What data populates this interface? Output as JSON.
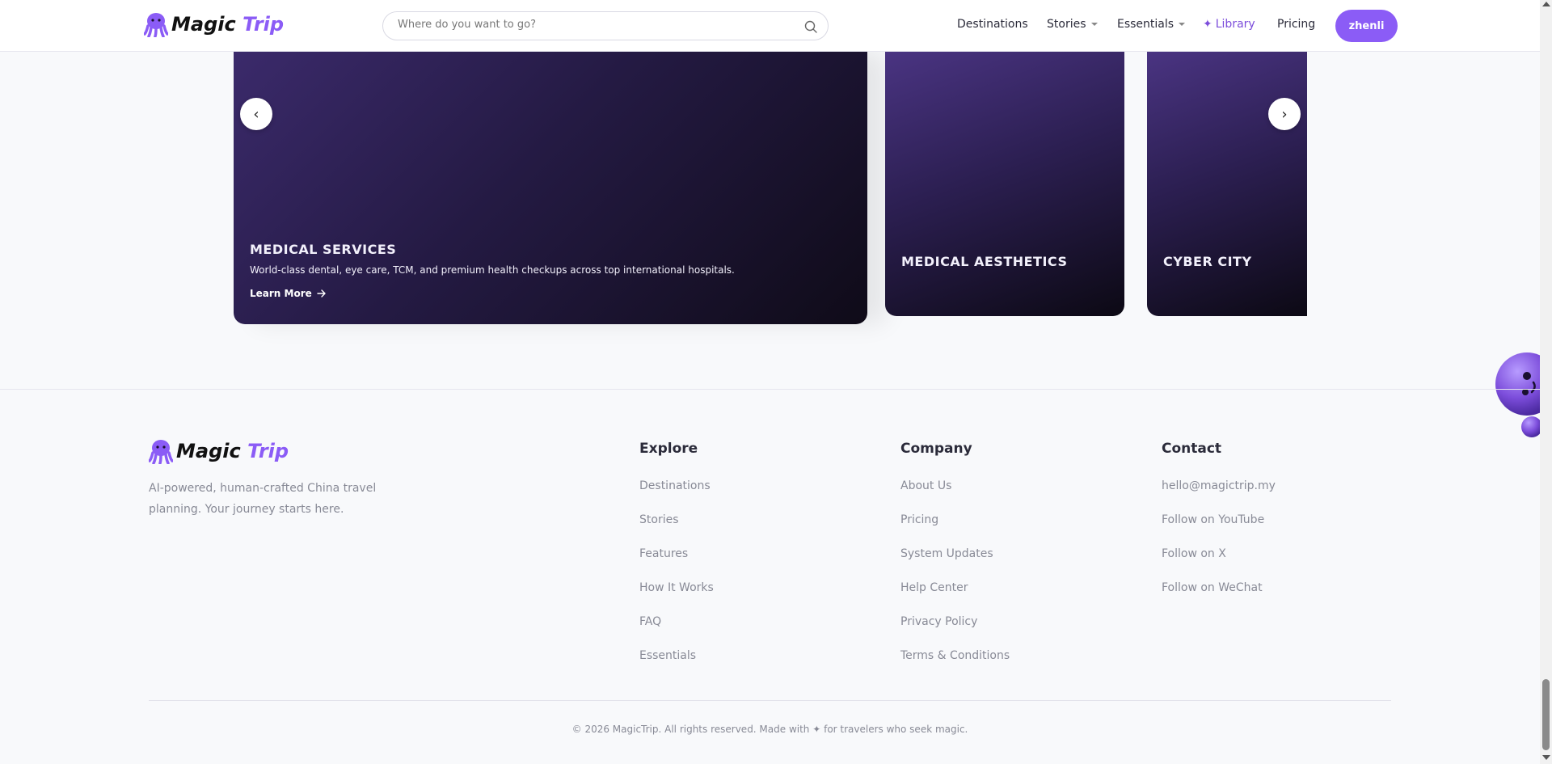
{
  "header": {
    "logo": {
      "word1": "Magic",
      "word2": "Trip"
    },
    "search": {
      "placeholder": "Where do you want to go?"
    },
    "nav": {
      "destinations": "Destinations",
      "stories": "Stories",
      "essentials": "Essentials",
      "library": "Library",
      "library_glyph": "✦",
      "pricing": "Pricing"
    },
    "user": "zhenli"
  },
  "carousel": {
    "prev": "‹",
    "next": "›",
    "cards": [
      {
        "title": "MEDICAL SERVICES",
        "description": "World-class dental, eye care, TCM, and premium health checkups across top international hospitals.",
        "link": "Learn More"
      },
      {
        "title": "MEDICAL AESTHETICS"
      },
      {
        "title": "CYBER CITY"
      }
    ]
  },
  "footer": {
    "logo": {
      "word1": "Magic",
      "word2": "Trip"
    },
    "tagline": "AI-powered, human-crafted China travel planning. Your journey starts here.",
    "explore": {
      "title": "Explore",
      "links": [
        "Destinations",
        "Stories",
        "Features",
        "How It Works",
        "FAQ",
        "Essentials"
      ]
    },
    "company": {
      "title": "Company",
      "links": [
        "About Us",
        "Pricing",
        "System Updates",
        "Help Center",
        "Privacy Policy",
        "Terms & Conditions"
      ]
    },
    "contact": {
      "title": "Contact",
      "links": [
        "hello@magictrip.my",
        "Follow on YouTube",
        "Follow on X",
        "Follow on WeChat"
      ]
    },
    "copyright": "© 2026 MagicTrip. All rights reserved. Made with ✦ for travelers who seek magic."
  },
  "colors": {
    "accent": "#8b5cf6",
    "card_dark": "#241a43"
  },
  "icons": [
    "octopus-logo-icon",
    "search-icon",
    "chevron-down-icon",
    "sparkle-icon",
    "arrow-right-icon",
    "mascot-icon"
  ]
}
